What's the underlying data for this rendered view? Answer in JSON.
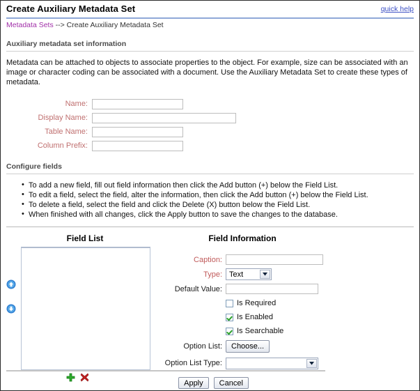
{
  "header": {
    "title": "Create Auxiliary Metadata Set",
    "quick_help": "quick help",
    "breadcrumb_link": "Metadata Sets",
    "breadcrumb_trail": " --> Create Auxiliary Metadata Set",
    "link_color": "#a12fa8",
    "quick_help_color": "#3b4fc4",
    "rule_color": "#8fa8d8"
  },
  "info_section": {
    "heading": "Auxiliary metadata set information",
    "description": "Metadata can be attached to objects to associate properties to the object. For example, size can be associated with an image or character coding can be associated with a document. Use the Auxiliary Metadata Set to create these types of metadata.",
    "fields": [
      {
        "label": "Name:",
        "value": "",
        "width_class": "w-name"
      },
      {
        "label": "Display Name:",
        "value": "",
        "width_class": "w-disp"
      },
      {
        "label": "Table Name:",
        "value": "",
        "width_class": "w-table"
      },
      {
        "label": "Column Prefix:",
        "value": "",
        "width_class": "w-prefix"
      }
    ],
    "label_color": "#c07070"
  },
  "configure_section": {
    "heading": "Configure fields",
    "bullets": [
      "To add a new field, fill out field information then click the Add button (+) below the Field List.",
      "To edit a field, select the field, alter the information, then click the Add button (+) below the Field List.",
      "To delete a field, select the field and click the Delete (X) button below the Field List.",
      "When finished with all changes, click the Apply button to save the changes to the database."
    ]
  },
  "field_list": {
    "heading": "Field List",
    "items": [],
    "move_up_title": "Move Up",
    "move_down_title": "Move Down",
    "add_title": "Add",
    "delete_title": "Delete"
  },
  "field_information": {
    "heading": "Field Information",
    "caption_label": "Caption:",
    "caption_value": "",
    "type_label": "Type:",
    "type_value": "Text",
    "default_value_label": "Default Value:",
    "default_value": "",
    "checkboxes": [
      {
        "label": "Is Required",
        "checked": false
      },
      {
        "label": "Is Enabled",
        "checked": true
      },
      {
        "label": "Is Searchable",
        "checked": true
      }
    ],
    "option_list_label": "Option List:",
    "option_list_button": "Choose...",
    "option_list_type_label": "Option List Type:",
    "option_list_type_value": "",
    "check_color": "#2aa02a"
  },
  "footer": {
    "apply_label": "Apply",
    "cancel_label": "Cancel"
  }
}
